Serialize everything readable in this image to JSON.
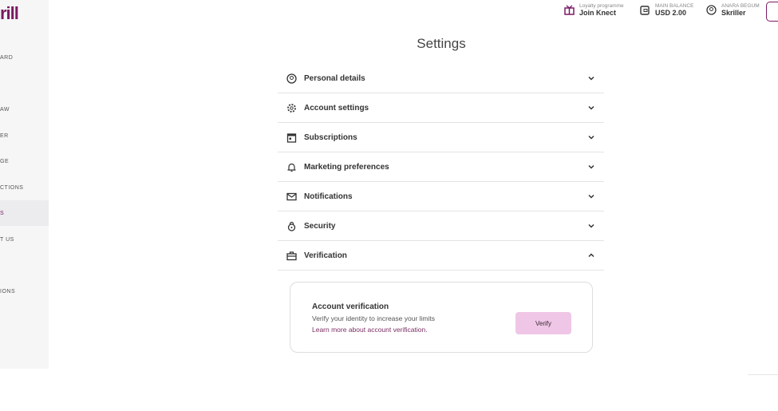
{
  "sidebar": {
    "logo": "rill",
    "items": [
      {
        "label": "ARD",
        "active": false
      },
      {
        "label": "AW",
        "active": false
      },
      {
        "label": "ER",
        "active": false
      },
      {
        "label": "GE",
        "active": false
      },
      {
        "label": "CTIONS",
        "active": false
      },
      {
        "label": "S",
        "active": true
      },
      {
        "label": "T US",
        "active": false
      },
      {
        "label": "IONS",
        "active": false
      }
    ]
  },
  "header": {
    "loyalty": {
      "caption": "Loyalty programme",
      "value": "Join Knect",
      "icon": "gift-icon"
    },
    "balance": {
      "caption": "MAIN BALANCE",
      "value": "USD 2.00",
      "icon": "wallet-icon"
    },
    "user": {
      "caption": "ANARA BEGUM",
      "value": "Skriller",
      "icon": "user-circle-icon"
    }
  },
  "page": {
    "title": "Settings"
  },
  "sections": [
    {
      "label": "Personal details",
      "icon": "user-circle-icon",
      "expanded": false
    },
    {
      "label": "Account settings",
      "icon": "gear-icon",
      "expanded": false
    },
    {
      "label": "Subscriptions",
      "icon": "calendar-icon",
      "expanded": false
    },
    {
      "label": "Marketing preferences",
      "icon": "bell-icon",
      "expanded": false
    },
    {
      "label": "Notifications",
      "icon": "envelope-icon",
      "expanded": false
    },
    {
      "label": "Security",
      "icon": "lock-icon",
      "expanded": false
    },
    {
      "label": "Verification",
      "icon": "briefcase-icon",
      "expanded": true
    }
  ],
  "verification": {
    "title": "Account verification",
    "description": "Verify your identity to increase your limits",
    "link": "Learn more about account verification.",
    "button": "Verify"
  },
  "colors": {
    "brand": "#7a1a63",
    "button": "#f0c6e6"
  }
}
